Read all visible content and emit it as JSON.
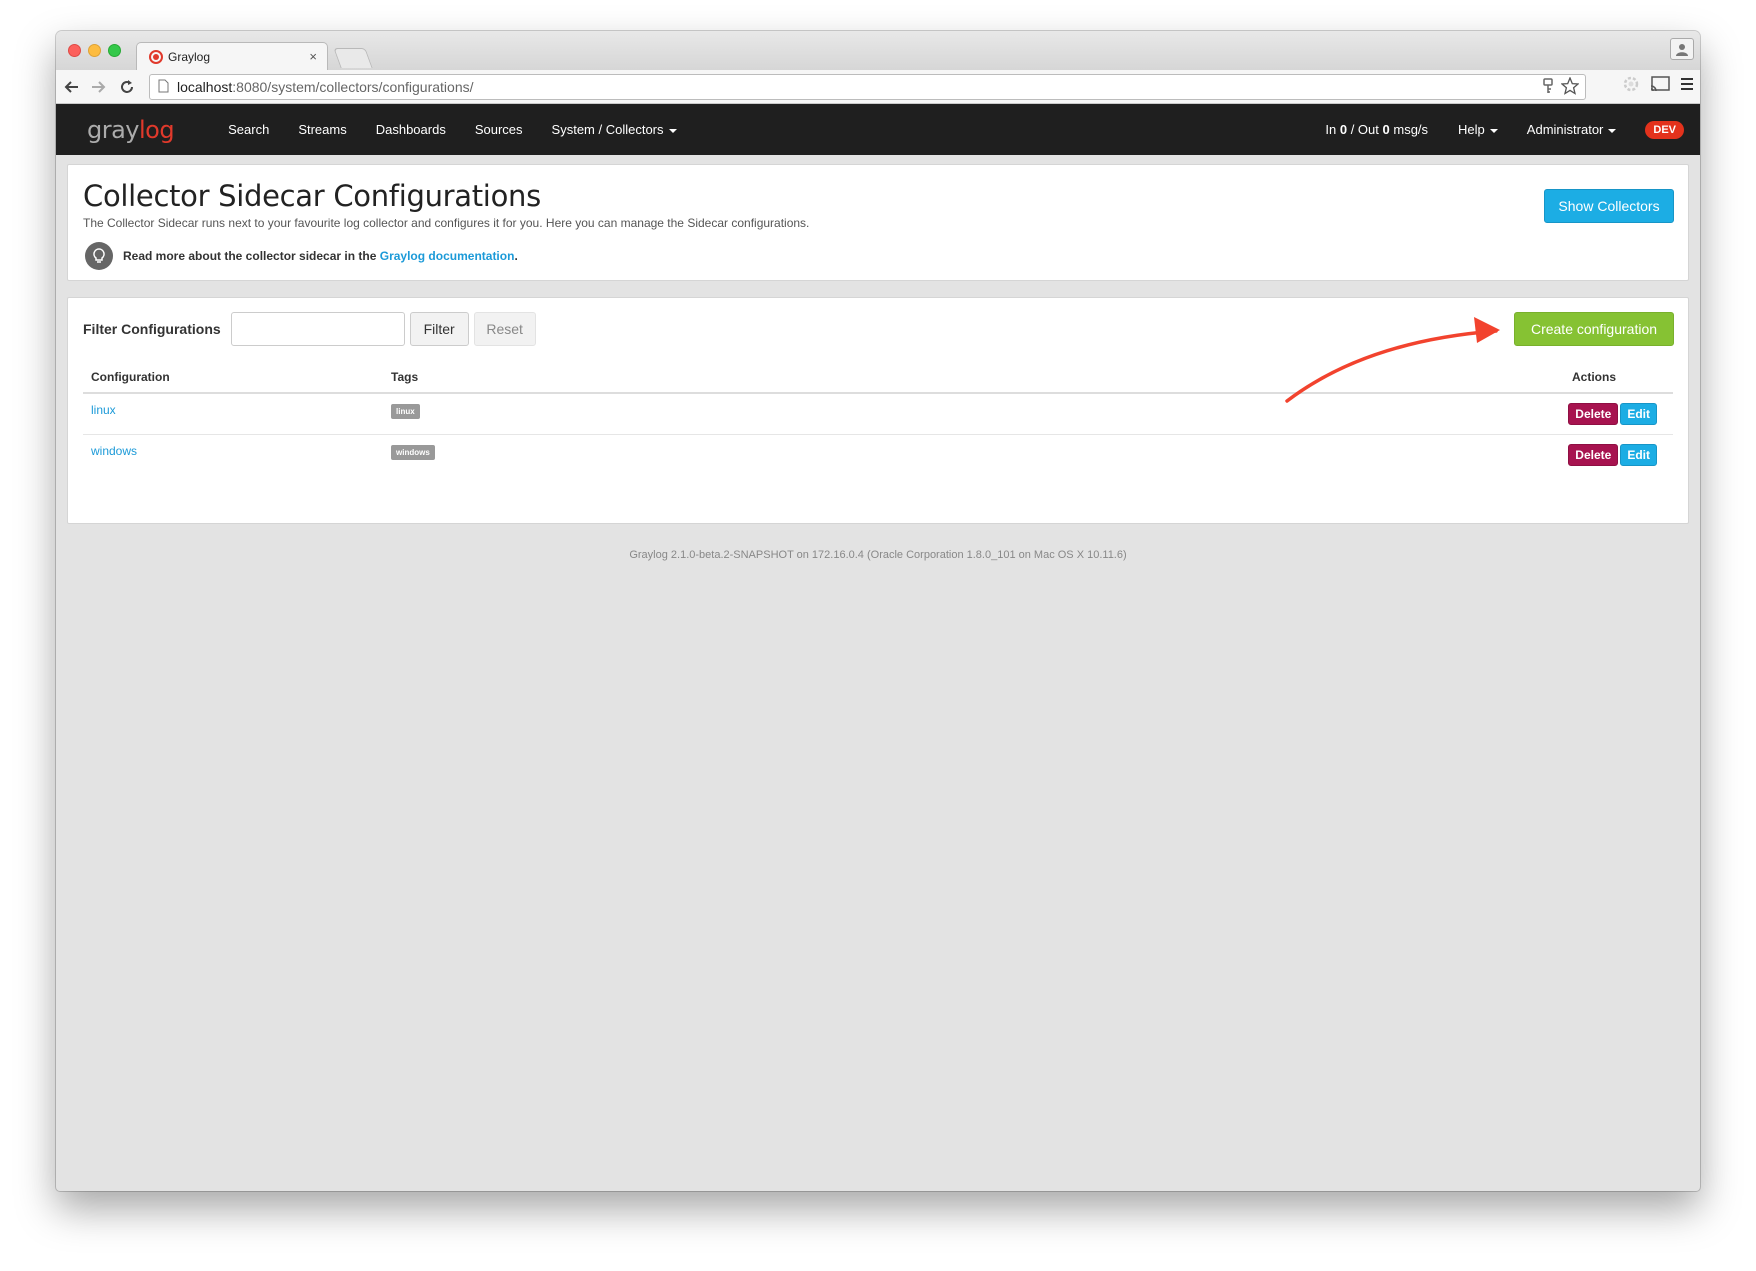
{
  "browser": {
    "tab_title": "Graylog",
    "tab_close": "×",
    "url_host": "localhost",
    "url_path": ":8080/system/collectors/configurations/"
  },
  "navbar": {
    "logo_gray": "gray",
    "logo_accent": "log",
    "links": {
      "search": "Search",
      "streams": "Streams",
      "dashboards": "Dashboards",
      "sources": "Sources",
      "system": "System / Collectors"
    },
    "throughput": {
      "in_label": "In",
      "in_value": "0",
      "separator": "/ Out",
      "out_value": "0",
      "unit": "msg/s"
    },
    "help": "Help",
    "user": "Administrator",
    "badge": "DEV"
  },
  "header": {
    "title": "Collector Sidecar Configurations",
    "description": "The Collector Sidecar runs next to your favourite log collector and configures it for you. Here you can manage the Sidecar configurations.",
    "doc_prefix": "Read more about the collector sidecar in the",
    "doc_link": "Graylog documentation",
    "doc_suffix": ".",
    "show_collectors": "Show Collectors"
  },
  "filter": {
    "label": "Filter Configurations",
    "input_value": "",
    "filter_button": "Filter",
    "reset_button": "Reset",
    "create_button": "Create configuration"
  },
  "table": {
    "columns": {
      "configuration": "Configuration",
      "tags": "Tags",
      "actions": "Actions"
    },
    "rows": [
      {
        "name": "linux",
        "tag": "linux",
        "delete": "Delete",
        "edit": "Edit"
      },
      {
        "name": "windows",
        "tag": "windows",
        "delete": "Delete",
        "edit": "Edit"
      }
    ]
  },
  "footer": "Graylog 2.1.0-beta.2-SNAPSHOT on 172.16.0.4 (Oracle Corporation 1.8.0_101 on Mac OS X 10.11.6)",
  "colors": {
    "nav_bg": "#1f1f1f",
    "primary": "#1cade4",
    "success": "#86c233",
    "danger": "#a7134f",
    "badge": "#e3321c",
    "annotation_arrow": "#f2432e"
  },
  "icons": {
    "back": "arrow-left-icon",
    "forward": "arrow-right-icon",
    "reload": "reload-icon",
    "page": "page-icon",
    "key": "key-icon",
    "star": "star-icon",
    "cast": "cast-icon",
    "menu": "hamburger-menu-icon",
    "profile": "profile-icon",
    "lightbulb": "lightbulb-icon"
  }
}
